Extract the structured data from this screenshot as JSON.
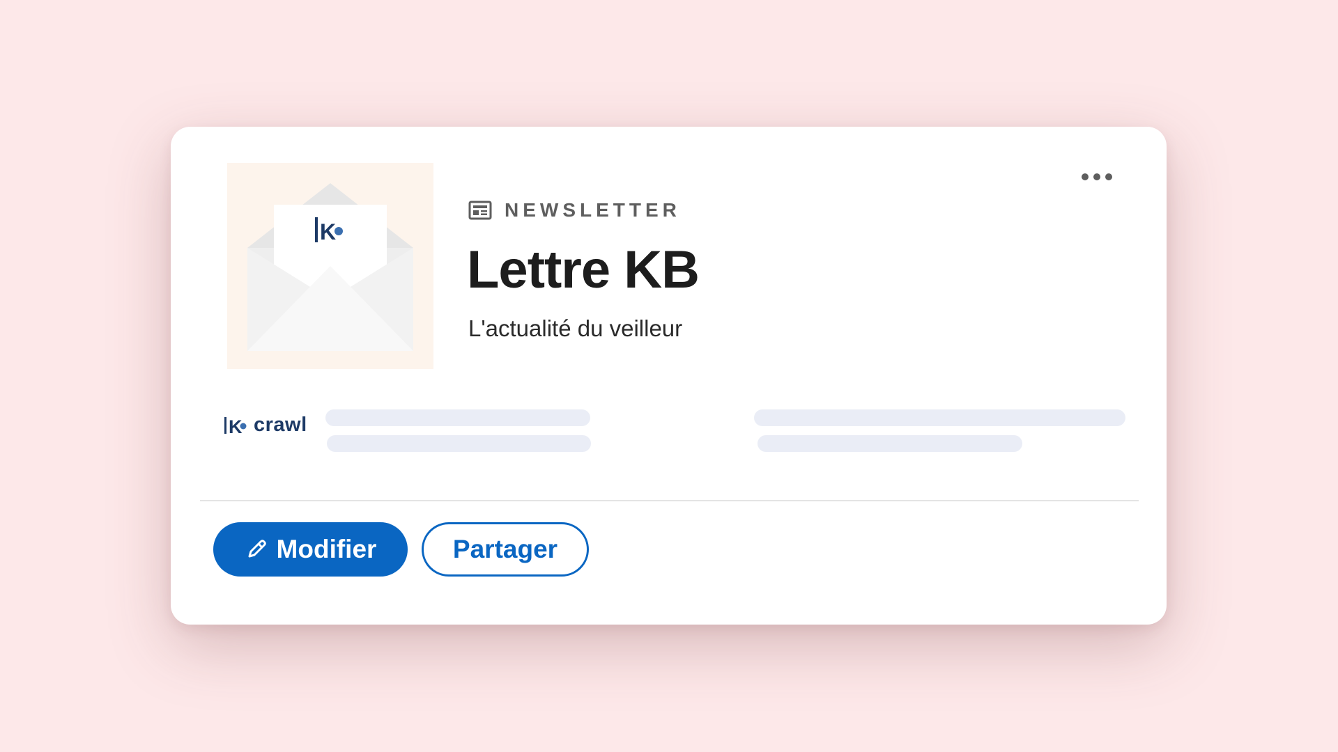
{
  "card": {
    "kind_label": "NEWSLETTER",
    "title": "Lettre KB",
    "subtitle": "L'actualité du veilleur",
    "brand": {
      "mark": "K",
      "name": "crawl"
    },
    "thumbnail": {
      "letter_mark": "K"
    },
    "actions": {
      "edit_label": "Modifier",
      "share_label": "Partager"
    },
    "icons": {
      "kind": "newspaper-icon",
      "edit": "pencil-icon",
      "more": "more-horizontal-icon"
    }
  },
  "colors": {
    "background": "#fde8e9",
    "card": "#ffffff",
    "accent": "#0a66c2",
    "brand_navy": "#1d3a66",
    "skeleton": "#eaedf6",
    "thumbnail_bg": "#fdf4ec"
  }
}
